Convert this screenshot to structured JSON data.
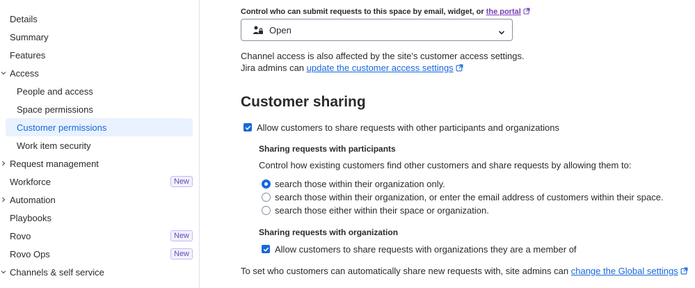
{
  "sidebar": {
    "items": [
      {
        "label": "Details"
      },
      {
        "label": "Summary"
      },
      {
        "label": "Features"
      },
      {
        "label": "Access"
      },
      {
        "label": "People and access"
      },
      {
        "label": "Space permissions"
      },
      {
        "label": "Customer permissions"
      },
      {
        "label": "Work item security"
      },
      {
        "label": "Request management"
      },
      {
        "label": "Workforce",
        "badge": "New"
      },
      {
        "label": "Automation"
      },
      {
        "label": "Playbooks"
      },
      {
        "label": "Rovo",
        "badge": "New"
      },
      {
        "label": "Rovo Ops",
        "badge": "New"
      },
      {
        "label": "Channels & self service"
      }
    ]
  },
  "channel": {
    "heading_prefix": "Control who can submit requests to this space by email, widget, or",
    "heading_link": "the portal",
    "select_value": "Open",
    "note_line1": "Channel access is also affected by the site's customer access settings.",
    "note_line2_prefix": "Jira admins can",
    "note_line2_link": "update the customer access settings"
  },
  "sharing": {
    "title": "Customer sharing",
    "allow_label": "Allow customers to share requests with other participants and organizations",
    "participants_heading": "Sharing requests with participants",
    "participants_desc": "Control how existing customers find other customers and share requests by allowing them to:",
    "options": [
      {
        "label": "search those within their organization only.",
        "checked": true
      },
      {
        "label": "search those within their organization, or enter the email address of customers within their space.",
        "checked": false
      },
      {
        "label": "search those either within their space or organization.",
        "checked": false
      }
    ],
    "org_heading": "Sharing requests with organization",
    "org_allow_label": "Allow customers to share requests with organizations they are a member of",
    "global_prefix": "To set who customers can automatically share new requests with, site admins can",
    "global_link": "change the Global settings"
  },
  "colors": {
    "accent": "#1868db",
    "active_bg": "#e9f2fe",
    "badge": "#5e4db2"
  }
}
